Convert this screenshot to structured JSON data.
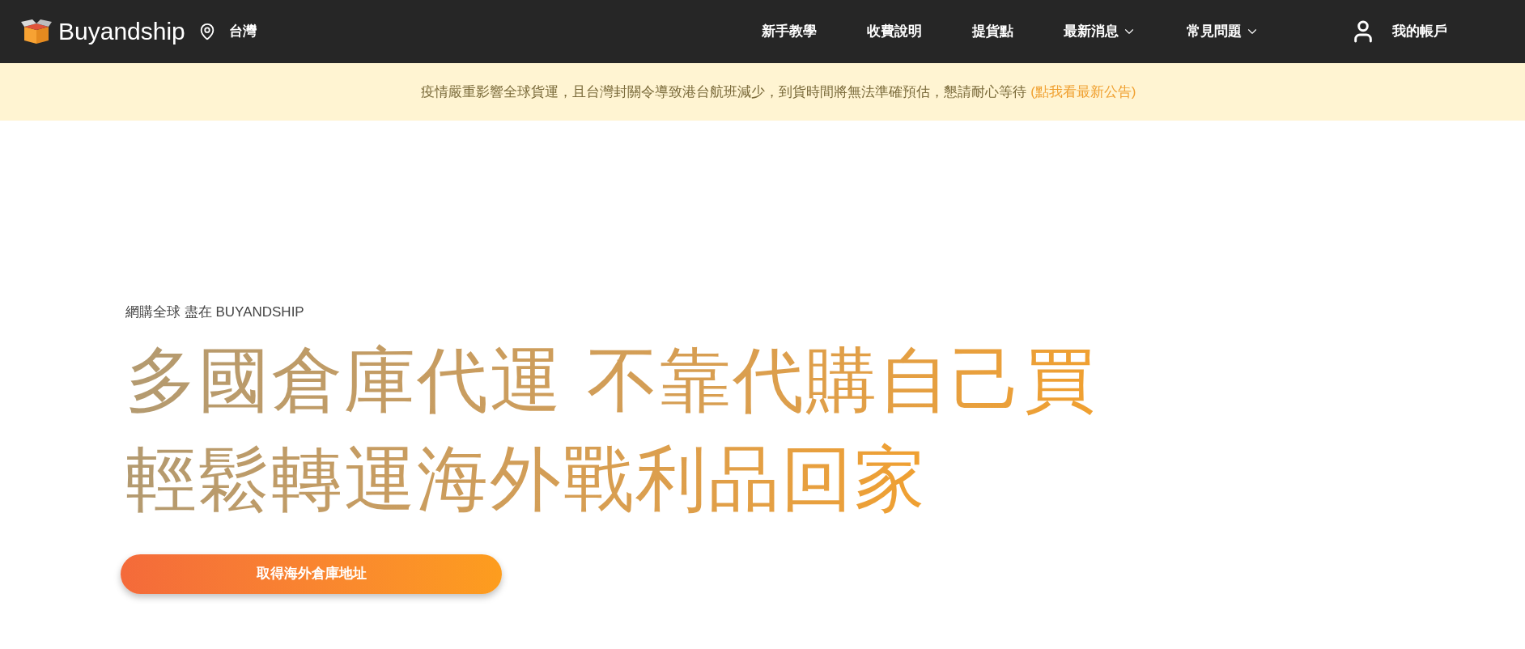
{
  "header": {
    "logo": "Buyandship",
    "location": "台灣",
    "nav": [
      {
        "label": "新手教學",
        "dropdown": false
      },
      {
        "label": "收費說明",
        "dropdown": false
      },
      {
        "label": "提貨點",
        "dropdown": false
      },
      {
        "label": "最新消息",
        "dropdown": true
      },
      {
        "label": "常見問題",
        "dropdown": true
      }
    ],
    "account": "我的帳戶"
  },
  "notice": {
    "text": "疫情嚴重影響全球貨運，且台灣封關令導致港台航班減少，到貨時間將無法準確預估，懇請耐心等待",
    "link": "(點我看最新公告)"
  },
  "hero": {
    "eyebrow": "網購全球 盡在 BUYANDSHIP",
    "headline": [
      "多國倉庫代運 不靠代購自己買",
      "輕鬆轉運海外戰利品回家"
    ],
    "cta": "取得海外倉庫地址"
  }
}
